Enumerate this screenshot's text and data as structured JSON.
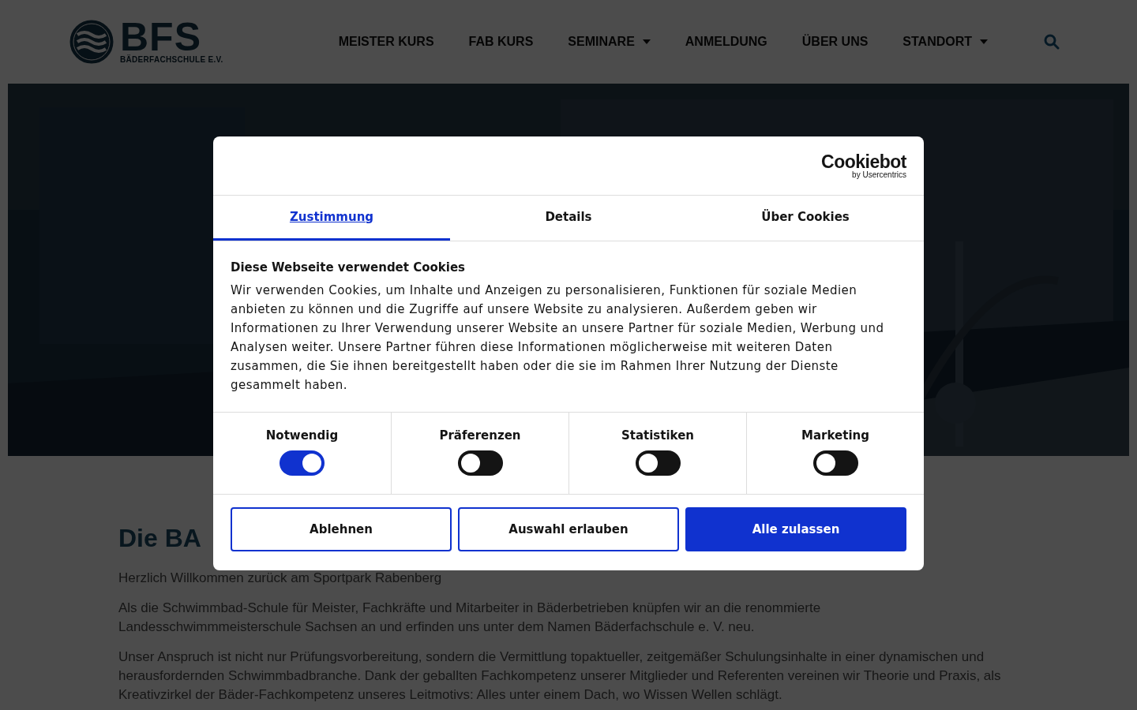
{
  "header": {
    "logo": {
      "mark": "BFS",
      "subtitle": "BÄDERFACHSCHULE E.V."
    },
    "nav": [
      {
        "label": "MEISTER KURS",
        "dropdown": false
      },
      {
        "label": "FAB KURS",
        "dropdown": false
      },
      {
        "label": "SEMINARE",
        "dropdown": true
      },
      {
        "label": "ANMELDUNG",
        "dropdown": false
      },
      {
        "label": "ÜBER UNS",
        "dropdown": false
      },
      {
        "label": "STANDORT",
        "dropdown": true
      }
    ]
  },
  "content": {
    "heading": "Die BA",
    "paragraphs": [
      "Herzlich Willkommen zurück am Sportpark Rabenberg",
      "Als die Schwimmbad-Schule für Meister, Fachkräfte und Mitarbeiter in Bäderbetrieben knüpfen wir an die renommierte Landesschwimmmeisterschule Sachsen an und erfinden uns unter dem Namen Bäderfachschule e. V. neu.",
      "Unser Anspruch ist nicht nur Prüfungsvorbereitung, sondern die Vermittlung topaktueller, zeitgemäßer Schulungsinhalte in einer dynamischen und herausfordernden Schwimmbadbranche. Dank der geballten Fachkompetenz unserer Mitglieder und Referenten vereinen wir Theorie und Praxis, als Kreativzirkel der Bäder-Fachkompetenz unseres Leitmotivs: Alles unter einem Dach, wo Wissen Wellen schlägt."
    ]
  },
  "cookie_dialog": {
    "brand": {
      "name": "Cookiebot",
      "byline": "by Usercentrics"
    },
    "tabs": [
      {
        "label": "Zustimmung",
        "selected": true
      },
      {
        "label": "Details",
        "selected": false
      },
      {
        "label": "Über Cookies",
        "selected": false
      }
    ],
    "title": "Diese Webseite verwendet Cookies",
    "text": "Wir verwenden Cookies, um Inhalte und Anzeigen zu personalisieren, Funktionen für soziale Medien anbieten zu können und die Zugriffe auf unsere Website zu analysieren. Außerdem geben wir Informationen zu Ihrer Verwendung unserer Website an unsere Partner für soziale Medien, Werbung und Analysen weiter. Unsere Partner führen diese Informationen möglicherweise mit weiteren Daten zusammen, die Sie ihnen bereitgestellt haben oder die sie im Rahmen Ihrer Nutzung der Dienste gesammelt haben.",
    "categories": [
      {
        "label": "Notwendig",
        "on": true
      },
      {
        "label": "Präferenzen",
        "on": false
      },
      {
        "label": "Statistiken",
        "on": false
      },
      {
        "label": "Marketing",
        "on": false
      }
    ],
    "buttons": [
      {
        "label": "Ablehnen",
        "kind": "outline"
      },
      {
        "label": "Auswahl erlauben",
        "kind": "outline"
      },
      {
        "label": "Alle zulassen",
        "kind": "primary"
      }
    ]
  }
}
